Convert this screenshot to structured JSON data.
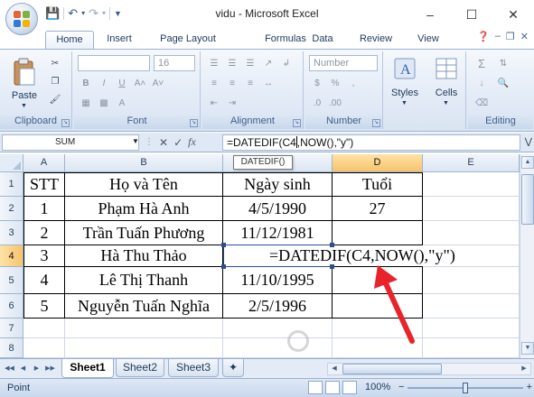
{
  "window": {
    "title": "vidu - Microsoft Excel",
    "controls": [
      "–",
      "☐",
      "✕"
    ]
  },
  "ribbon": {
    "tabs": [
      "Home",
      "Insert",
      "Page Layout",
      "Formulas",
      "Data",
      "Review",
      "View"
    ],
    "active_tab": "Home",
    "groups": {
      "clipboard": {
        "label": "Clipboard",
        "paste": "Paste"
      },
      "font": {
        "label": "Font",
        "size": "16",
        "bold": "B",
        "italic": "I",
        "underline": "U"
      },
      "alignment": {
        "label": "Alignment"
      },
      "number": {
        "label": "Number",
        "format": "Number",
        "currency": "$",
        "percent": "%"
      },
      "styles": {
        "label": "Styles"
      },
      "cells": {
        "label": "Cells"
      },
      "editing": {
        "label": "Editing",
        "sigma": "Σ"
      }
    }
  },
  "formula_bar": {
    "name_box": "SUM",
    "formula_before_cursor": "=DATEDIF(C4",
    "formula_after_cursor": ",NOW(),\"y\")",
    "fx": "fx",
    "cancel": "✕",
    "enter": "✓",
    "tooltip": "DATEDIF()"
  },
  "sheet": {
    "columns": [
      "A",
      "B",
      "C",
      "D",
      "E"
    ],
    "rows": [
      "1",
      "2",
      "3",
      "4",
      "5",
      "6",
      "7",
      "8"
    ],
    "header_row": [
      "STT",
      "Họ và Tên",
      "Ngày sinh",
      "Tuổi"
    ],
    "data": [
      [
        "1",
        "Phạm Hà Anh",
        "4/5/1990",
        "27"
      ],
      [
        "2",
        "Trần Tuấn Phương",
        "11/12/1981",
        ""
      ],
      [
        "3",
        "Hà Thu Thảo",
        "",
        ""
      ],
      [
        "4",
        "Lê Thị Thanh",
        "11/10/1995",
        ""
      ],
      [
        "5",
        "Nguyễn Tuấn Nghĩa",
        "2/5/1996",
        ""
      ]
    ],
    "editing_cell_text": "=DATEDIF(C4,NOW(),\"y\")",
    "selected_column": "D",
    "selected_row": "4"
  },
  "sheet_tabs": [
    "Sheet1",
    "Sheet2",
    "Sheet3"
  ],
  "active_sheet": "Sheet1",
  "status": {
    "mode": "Point",
    "zoom": "100%",
    "zoom_fraction": 0.5
  },
  "colors": {
    "accent": "#1e395b",
    "selection_header": "#f8c36b",
    "arrow": "#e8232b"
  }
}
